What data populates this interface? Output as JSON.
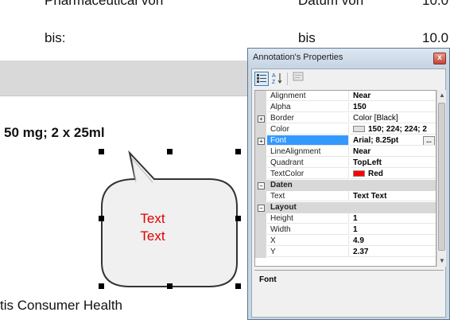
{
  "document": {
    "top_partial_left": "Pharmaceutical von",
    "top_partial_mid": "Datum von",
    "top_partial_right": "10.0",
    "bis_label": "bis:",
    "bis_label_2": "bis",
    "bis_value": "10.0",
    "dosage_text": "50 mg; 2 x 25ml",
    "bottom_text": "tis Consumer Health"
  },
  "annotation_shape": {
    "line1": "Text",
    "line2": "Text",
    "text_color": "#e00000"
  },
  "properties_window": {
    "title": "Annotation's Properties",
    "close_glyph": "x",
    "toolbar": {
      "categorized_icon": "categorized-icon",
      "alphabetical_icon": "alphabetical-icon",
      "property_pages_icon": "property-pages-icon"
    },
    "rows": [
      {
        "name": "Alignment",
        "value": "Near"
      },
      {
        "name": "Alpha",
        "value": "150"
      },
      {
        "name": "Border",
        "value": "Color [Black]",
        "expandable": true
      },
      {
        "name": "Color",
        "value": "150; 224; 224; 2",
        "swatch": "#e0e0e0"
      },
      {
        "name": "Font",
        "value": "Arial; 8.25pt",
        "expandable": true,
        "selected": true,
        "ellipsis": "..."
      },
      {
        "name": "LineAlignment",
        "value": "Near"
      },
      {
        "name": "Quadrant",
        "value": "TopLeft"
      },
      {
        "name": "TextColor",
        "value": "Red",
        "swatch": "#ff0000"
      }
    ],
    "category_daten": "Daten",
    "rows_daten": [
      {
        "name": "Text",
        "value": "Text Text"
      }
    ],
    "category_layout": "Layout",
    "rows_layout": [
      {
        "name": "Height",
        "value": "1"
      },
      {
        "name": "Width",
        "value": "1"
      },
      {
        "name": "X",
        "value": "4.9"
      },
      {
        "name": "Y",
        "value": "2.37"
      }
    ],
    "description_title": "Font",
    "collapse_glyph": "−",
    "expand_glyph": "+"
  }
}
